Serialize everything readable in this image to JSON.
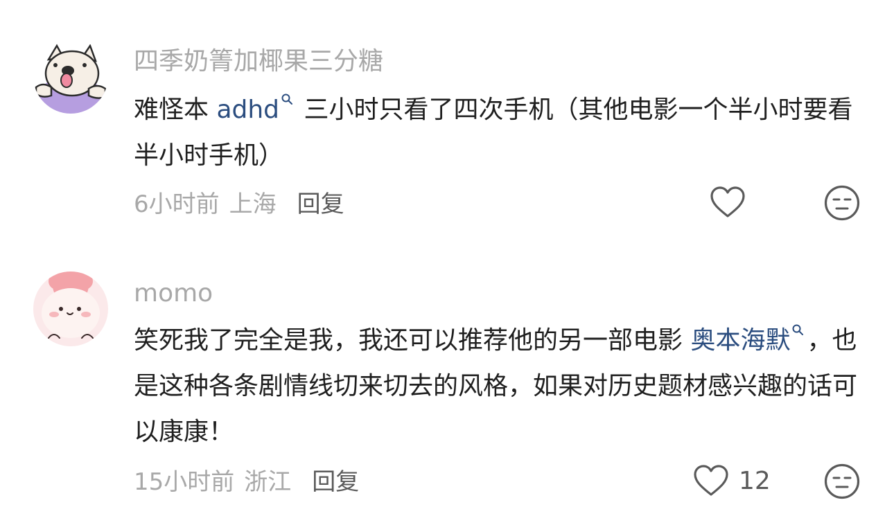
{
  "comments": [
    {
      "username": "四季奶箐加椰果三分糖",
      "text_before": "难怪本 ",
      "link_text": "adhd",
      "text_after": " 三小时只看了四次手机（其他电影一个半小时要看半小时手机）",
      "time": "6小时前",
      "location": "上海",
      "reply_label": "回复",
      "like_count": "",
      "avatar_icon": "dog-avatar-icon"
    },
    {
      "username": "momo",
      "text_before": "笑死我了完全是我，我还可以推荐他的另一部电影 ",
      "link_text": "奥本海默",
      "text_after": "，也是这种各条剧情线切来切去的风格，如果对历史题材感兴趣的话可以康康！",
      "time": "15小时前",
      "location": "浙江",
      "reply_label": "回复",
      "like_count": "12",
      "avatar_icon": "pink-character-avatar-icon"
    }
  ],
  "colors": {
    "username": "#a8a8a8",
    "body_text": "#1f1f1f",
    "link": "#2b4d7f",
    "meta": "#a8a8a8",
    "action": "#5a5a5a"
  },
  "icons": [
    "search-icon",
    "heart-icon",
    "dislike-face-icon"
  ]
}
